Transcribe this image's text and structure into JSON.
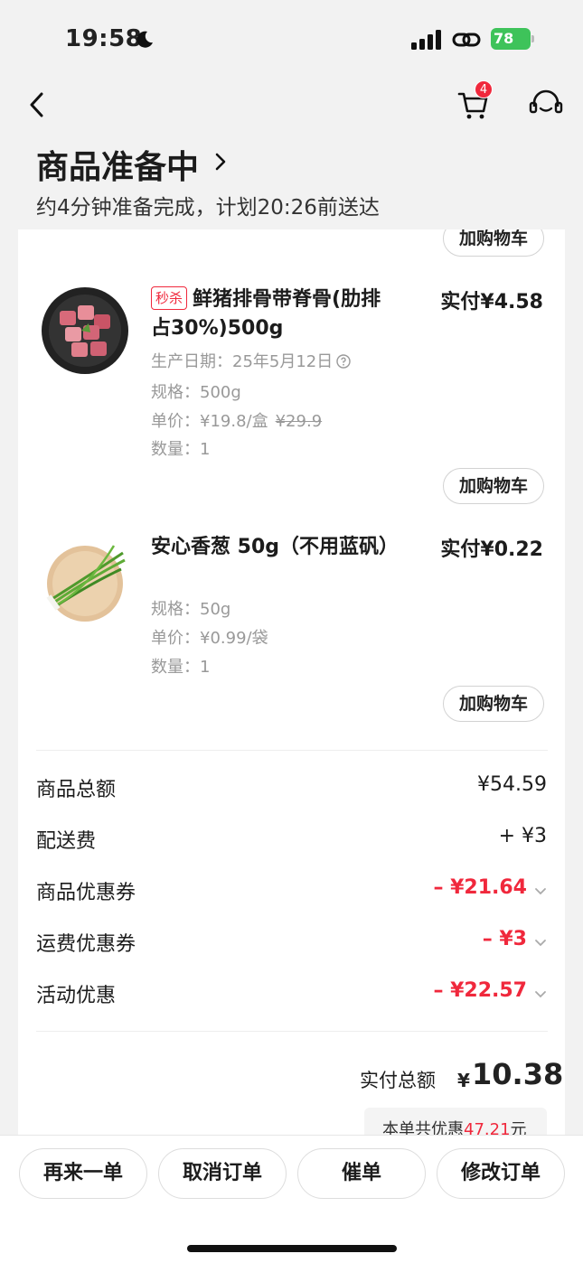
{
  "status_bar": {
    "time": "19:58",
    "battery": "78"
  },
  "nav": {
    "cart_count": "4"
  },
  "order": {
    "status_title": "商品准备中",
    "status_subtitle": "约4分钟准备完成，计划20:26前送达"
  },
  "add_cart_label": "加购物车",
  "items": [
    {
      "tag": "秒杀",
      "name": "鲜猪排骨带脊骨(肋排占30%)500g",
      "paid": "实付¥4.58",
      "production_date": "生产日期：25年5月12日",
      "spec": "规格：500g",
      "unit_price": "单价：¥19.8/盒",
      "original_price": "¥29.9",
      "quantity": "数量：1"
    },
    {
      "name": "安心香葱 50g（不用蓝矾）",
      "paid": "实付¥0.22",
      "spec": "规格：50g",
      "unit_price": "单价：¥0.99/袋",
      "quantity": "数量：1"
    }
  ],
  "summary": {
    "goods_total_label": "商品总额",
    "goods_total": "¥54.59",
    "delivery_label": "配送费",
    "delivery": "+ ¥3",
    "goods_coupon_label": "商品优惠券",
    "goods_coupon": "– ¥21.64",
    "shipping_coupon_label": "运费优惠券",
    "shipping_coupon": "– ¥3",
    "activity_label": "活动优惠",
    "activity": "– ¥22.57",
    "total_label": "实付总额",
    "total_currency": "¥",
    "total": "10.38",
    "saving_prefix": "本单共优惠",
    "saving_amount": "47.21",
    "saving_suffix": "元"
  },
  "actions": {
    "reorder": "再来一单",
    "cancel": "取消订单",
    "urge": "催单",
    "modify": "修改订单"
  },
  "colors": {
    "accent_red": "#f0283c",
    "battery_green": "#3ec35a"
  },
  "icons": [
    "moon-icon",
    "signal-icon",
    "link-icon",
    "back-arrow-icon",
    "cart-icon",
    "customer-service-icon",
    "chevron-right-icon",
    "help-icon",
    "chevron-down-icon"
  ]
}
